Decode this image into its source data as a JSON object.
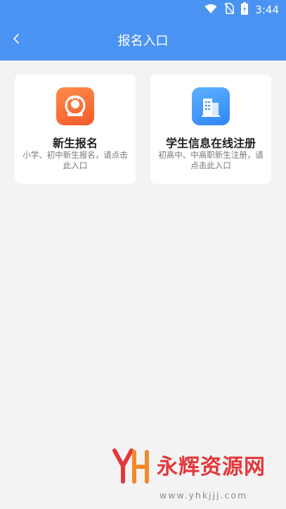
{
  "status_bar": {
    "time": "3:44"
  },
  "nav": {
    "title": "报名入口"
  },
  "cards": [
    {
      "title": "新生报名",
      "description": "小学、初中新生报名，请点击此入口"
    },
    {
      "title": "学生信息在线注册",
      "description": "初高中、中高职新生注册，请点击此入口"
    }
  ],
  "watermark": {
    "brand": "永辉资源网",
    "url": "www.yhkjjj.com"
  }
}
